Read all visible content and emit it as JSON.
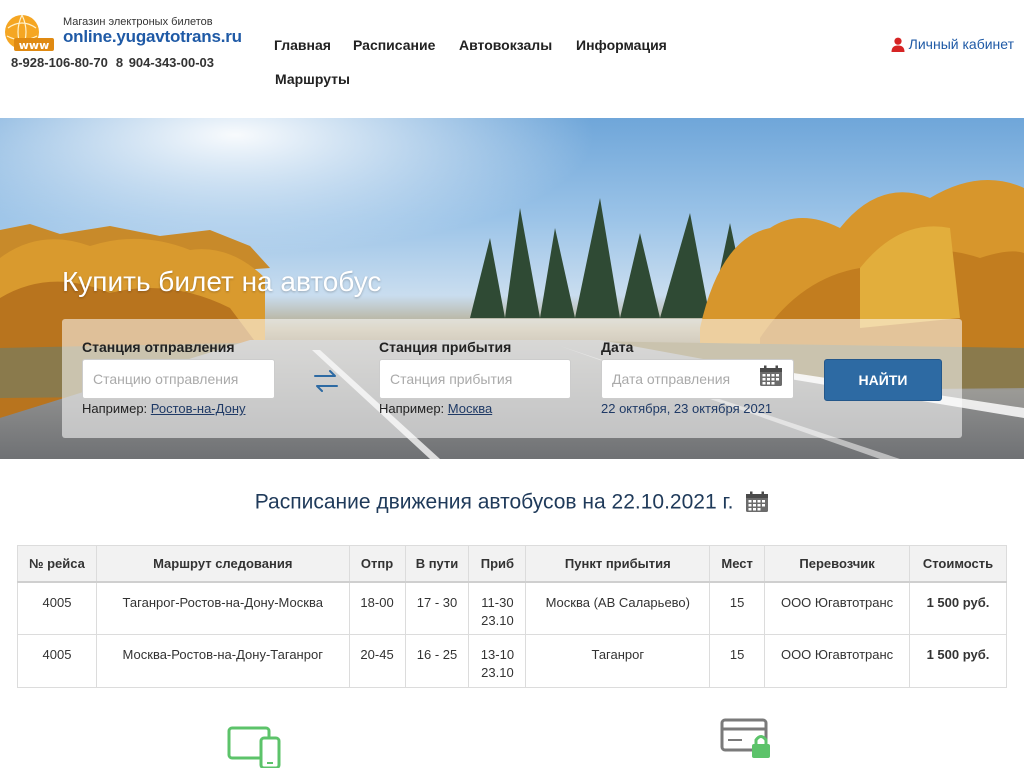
{
  "header": {
    "logo_tagline": "Магазин электроных билетов",
    "logo_site": "online.yugavtotrans.ru",
    "logo_globe_text": "www",
    "phones": [
      "8-928-106-80-70",
      "8 904-343-00-03"
    ],
    "nav": [
      "Главная",
      "Расписание",
      "Автовокзалы",
      "Информация",
      "Маршруты"
    ],
    "cabinet_label": "Личный кабинет"
  },
  "hero": {
    "title": "Купить билет на автобус",
    "departure": {
      "label": "Станция отправления",
      "placeholder": "Станцию отправления",
      "hint_prefix": "Например:",
      "hint_example": "Ростов-на-Дону"
    },
    "arrival": {
      "label": "Станция прибытия",
      "placeholder": "Станция прибытия",
      "hint_prefix": "Например:",
      "hint_example": "Москва"
    },
    "date": {
      "label": "Дата",
      "placeholder": "Дата отправления",
      "hint": "22 октября, 23 октября 2021"
    },
    "find_button": "НАЙТИ"
  },
  "schedule": {
    "title": "Расписание движения автобусов на 22.10.2021 г.",
    "columns": [
      "№ рейса",
      "Маршрут следования",
      "Отпр",
      "В пути",
      "Приб",
      "Пункт прибытия",
      "Мест",
      "Перевозчик",
      "Стоимость"
    ],
    "rows": [
      {
        "trip": "4005",
        "route": "Таганрог-Ростов-на-Дону-Москва",
        "depart": "18-00",
        "duration": "17 - 30",
        "arrive_time": "11-30",
        "arrive_date": "23.10",
        "destination": "Москва (АВ Саларьево)",
        "seats": "15",
        "carrier": "ООО Югавтотранс",
        "price": "1 500 руб."
      },
      {
        "trip": "4005",
        "route": "Москва-Ростов-на-Дону-Таганрог",
        "depart": "20-45",
        "duration": "16 - 25",
        "arrive_time": "13-10",
        "arrive_date": "23.10",
        "destination": "Таганрог",
        "seats": "15",
        "carrier": "ООО Югавтотранс",
        "price": "1 500 руб."
      }
    ]
  },
  "colors": {
    "brand_blue": "#1f5aa6",
    "button_blue": "#2d6aa3",
    "title_navy": "#1f3a5a",
    "feature_green": "#5cc36a",
    "cabinet_icon_red": "#d62424"
  },
  "icons": [
    "user-icon",
    "swap-arrows-icon",
    "calendar-icon",
    "devices-icon",
    "secure-card-icon"
  ]
}
